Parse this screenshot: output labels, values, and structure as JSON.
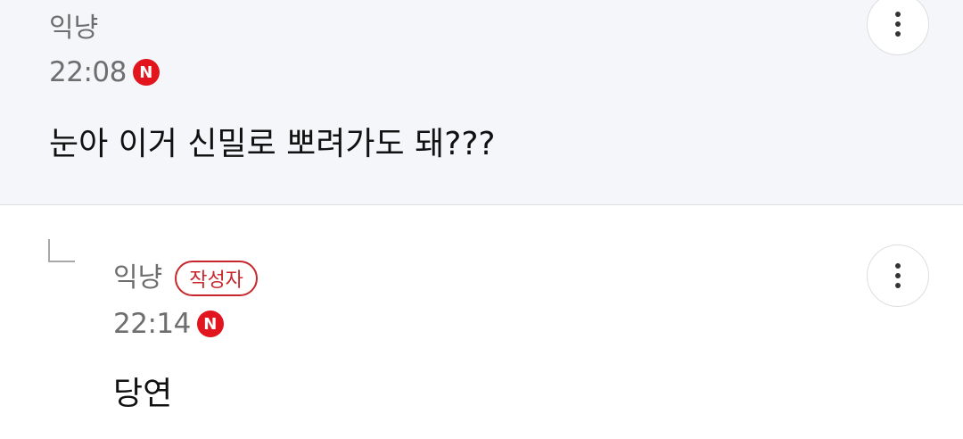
{
  "comments": [
    {
      "author": "익냥",
      "time": "22:08",
      "new_badge": "N",
      "text": "눈아 이거 신밀로 뽀려가도 돼???",
      "more_icon": "more-vertical-icon"
    },
    {
      "author": "익냥",
      "author_tag": "작성자",
      "time": "22:14",
      "new_badge": "N",
      "text": "당연",
      "reply_icon": "reply-corner-icon",
      "more_icon": "more-vertical-icon"
    }
  ],
  "colors": {
    "comment_bg": "#f4f6f9",
    "badge_red": "#e2141d",
    "tag_red": "#c8262d",
    "meta_gray": "#6e6e6e"
  }
}
